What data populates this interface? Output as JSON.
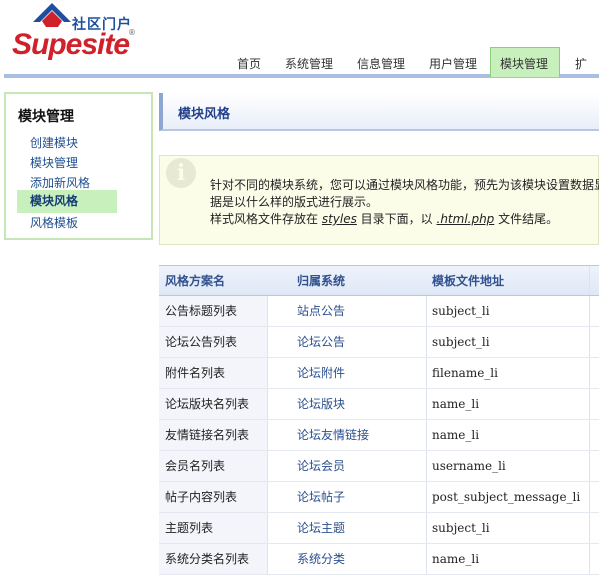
{
  "logo": {
    "name_cn": "社区门户",
    "name_en": "Supesite",
    "trademark": "®"
  },
  "nav": {
    "tabs": [
      {
        "label": "首页"
      },
      {
        "label": "系统管理"
      },
      {
        "label": "信息管理"
      },
      {
        "label": "用户管理"
      },
      {
        "label": "模块管理",
        "active": true
      },
      {
        "label": "扩"
      }
    ]
  },
  "sidebar": {
    "title": "模块管理",
    "items": [
      {
        "label": "创建模块"
      },
      {
        "label": "模块管理"
      },
      {
        "label": "添加新风格"
      },
      {
        "label": "模块风格",
        "active": true
      },
      {
        "label": "风格模板"
      }
    ]
  },
  "page": {
    "title": "模块风格"
  },
  "tip": {
    "icon": "info-icon",
    "line1": "针对不同的模块系统，您可以通过模块风格功能，预先为该模块设置数据显",
    "line2": "据是以什么样的版式进行展示。",
    "line3_prefix": "样式风格文件存放在 ",
    "line3_dir": "styles",
    "line3_mid": " 目录下面，以 ",
    "line3_ext": ".html.php",
    "line3_suffix": " 文件结尾。"
  },
  "table": {
    "columns": [
      "风格方案名",
      "归属系统",
      "模板文件地址"
    ],
    "rows": [
      [
        "公告标题列表",
        "站点公告",
        "subject_li"
      ],
      [
        "论坛公告列表",
        "论坛公告",
        "subject_li"
      ],
      [
        "附件名列表",
        "论坛附件",
        "filename_li"
      ],
      [
        "论坛版块名列表",
        "论坛版块",
        "name_li"
      ],
      [
        "友情链接名列表",
        "论坛友情链接",
        "name_li"
      ],
      [
        "会员名列表",
        "论坛会员",
        "username_li"
      ],
      [
        "帖子内容列表",
        "论坛帖子",
        "post_subject_message_li"
      ],
      [
        "主题列表",
        "论坛主题",
        "subject_li"
      ],
      [
        "系统分类名列表",
        "系统分类",
        "name_li"
      ]
    ]
  },
  "colors": {
    "accent_green": "#c7f0bd",
    "brand_red": "#d0202a",
    "brand_blue": "#1d4f9e",
    "link_blue": "#2b4f8e"
  }
}
